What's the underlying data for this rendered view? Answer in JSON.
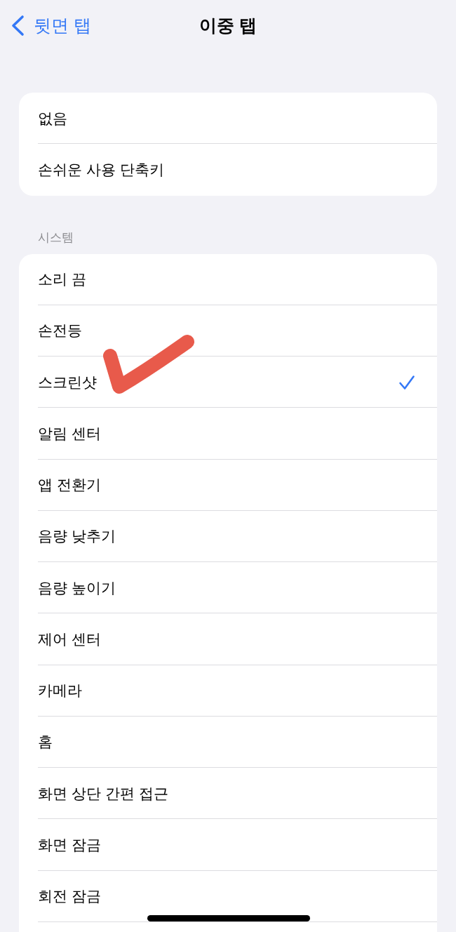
{
  "nav": {
    "back_label": "뒷면 탭",
    "title": "이중 탭"
  },
  "groups": [
    {
      "items": [
        {
          "label": "없음",
          "selected": false
        },
        {
          "label": "손쉬운 사용 단축키",
          "selected": false
        }
      ]
    },
    {
      "header": "시스템",
      "items": [
        {
          "label": "소리 끔",
          "selected": false
        },
        {
          "label": "손전등",
          "selected": false
        },
        {
          "label": "스크린샷",
          "selected": true
        },
        {
          "label": "알림 센터",
          "selected": false
        },
        {
          "label": "앱 전환기",
          "selected": false
        },
        {
          "label": "음량 낮추기",
          "selected": false
        },
        {
          "label": "음량 높이기",
          "selected": false
        },
        {
          "label": "제어 센터",
          "selected": false
        },
        {
          "label": "카메라",
          "selected": false
        },
        {
          "label": "홈",
          "selected": false
        },
        {
          "label": "화면 상단 간편 접근",
          "selected": false
        },
        {
          "label": "화면 잠금",
          "selected": false
        },
        {
          "label": "회전 잠금",
          "selected": false
        }
      ]
    }
  ]
}
